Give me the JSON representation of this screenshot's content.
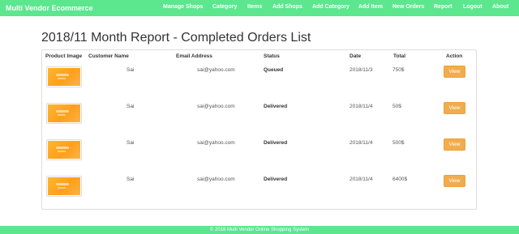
{
  "brand": "Multi Vendor Ecommerce",
  "nav": [
    "Manage Shops",
    "Category",
    "Items",
    "Add Shops",
    "Add Category",
    "Add Item",
    "New Orders",
    "Report",
    "Logout",
    "About"
  ],
  "page_title": "2018/11 Month Report - Completed Orders List",
  "columns": [
    "Product Image",
    "Customer Name",
    "Email Address",
    "Status",
    "Date",
    "Total",
    "Action"
  ],
  "rows": [
    {
      "customer": "Sai",
      "email": "sai@yahoo.com",
      "status": "Queued",
      "date": "2018/11/3",
      "total": "750$",
      "action": "View"
    },
    {
      "customer": "Sai",
      "email": "sai@yahoo.com",
      "status": "Delivered",
      "date": "2018/11/4",
      "total": "50$",
      "action": "View"
    },
    {
      "customer": "Sai",
      "email": "sai@yahoo.com",
      "status": "Delivered",
      "date": "2018/11/4",
      "total": "500$",
      "action": "View"
    },
    {
      "customer": "Sai",
      "email": "sai@yahoo.com",
      "status": "Delivered",
      "date": "2018/11/4",
      "total": "6400$",
      "action": "View"
    }
  ],
  "footer": "© 2018 Multi Vendor Online Shopping System",
  "colors": {
    "navbar": "#5ce68e",
    "button": "#f0ad4e"
  }
}
